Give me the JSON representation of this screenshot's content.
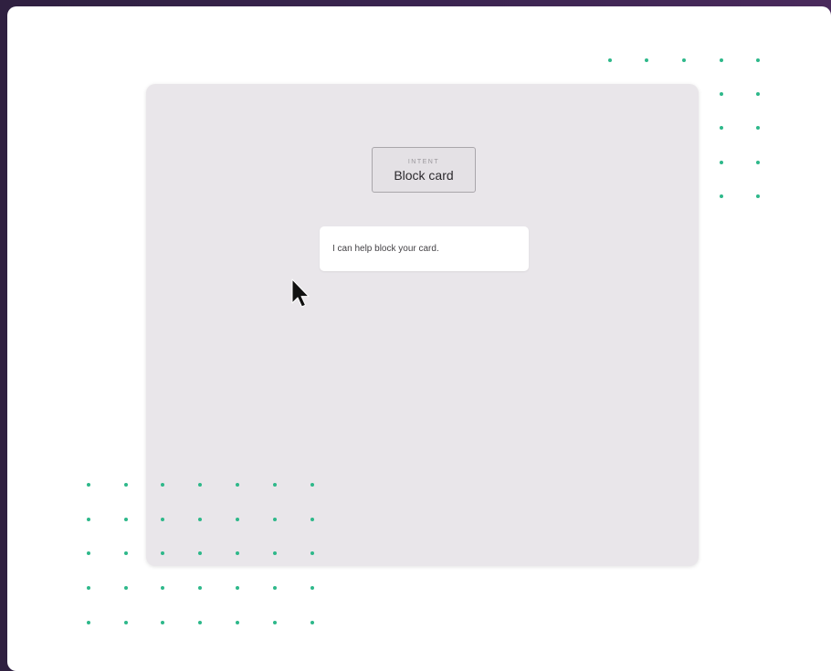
{
  "intent": {
    "caption": "INTENT",
    "name": "Block card"
  },
  "bot_message": "I can help block your card.",
  "colors": {
    "frame": "#3a2450",
    "panel": "#ffffff",
    "canvas": "#e9e6ea",
    "dots": "#2eb88a",
    "intent_border": "#a9a6ab"
  },
  "icons": {
    "cursor": "arrow-cursor-icon"
  }
}
